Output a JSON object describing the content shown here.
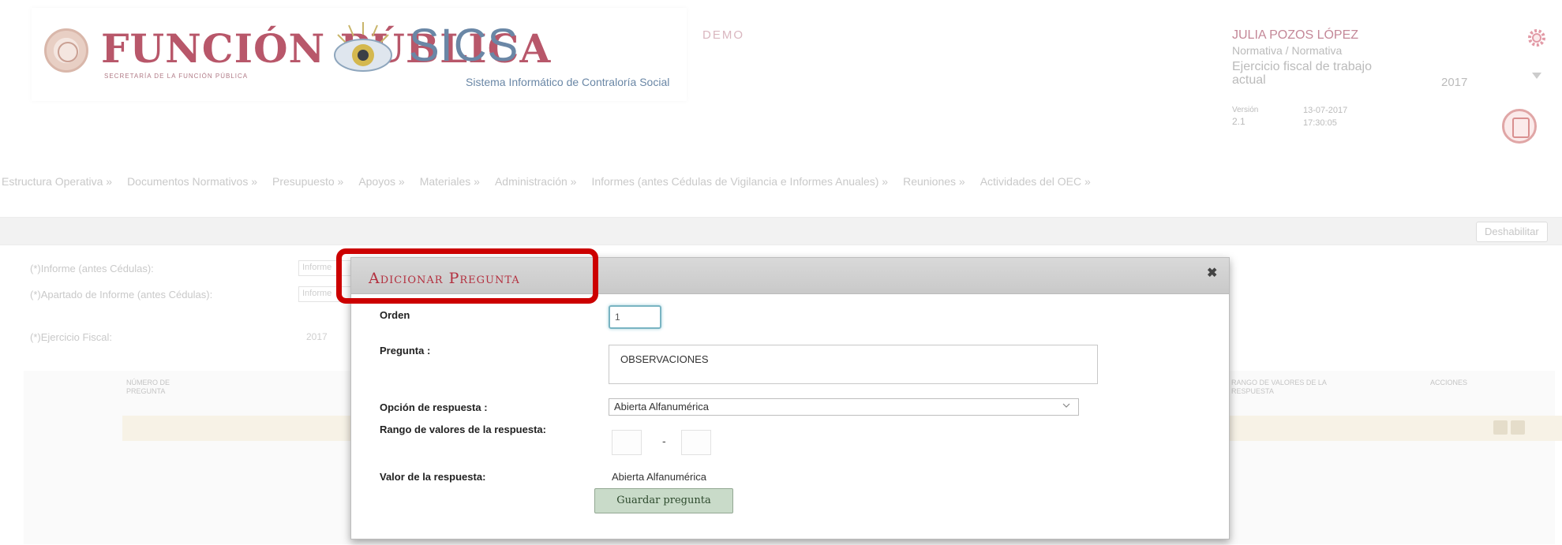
{
  "header": {
    "fp_title": "FUNCIÓN PÚBLICA",
    "fp_subtitle": "SECRETARÍA DE LA FUNCIÓN PÚBLICA",
    "app_title": "SICS",
    "app_subtitle": "Sistema Informático de Contraloría Social",
    "environment": "DEMO"
  },
  "user": {
    "name": "JULIA POZOS LÓPEZ",
    "role": "Normativa / Normativa",
    "fiscal_label": "Ejercicio fiscal de trabajo actual",
    "fiscal_year": "2017",
    "version_label": "Versión",
    "version": "2.1",
    "date": "13-07-2017",
    "time": "17:30:05"
  },
  "menu": [
    "Estructura Operativa »",
    "Documentos Normativos »",
    "Presupuesto »",
    "Apoyos »",
    "Materiales »",
    "Administración »",
    "Informes (antes Cédulas de Vigilancia e Informes Anuales) »",
    "Reuniones »",
    "Actividades del OEC »"
  ],
  "toolbar": {
    "disable_label": "Deshabilitar"
  },
  "form": {
    "informe_label": "(*)Informe (antes Cédulas):",
    "informe_value": "Informe",
    "apartado_label": "(*)Apartado de Informe (antes Cédulas):",
    "apartado_value": "Informe",
    "ejercicio_label": "(*)Ejercicio Fiscal:",
    "ejercicio_value": "2017"
  },
  "table": {
    "col_1": "NÚMERO DE PREGUNTA",
    "col_2": "RANGO DE VALORES DE LA RESPUESTA",
    "col_3": "ACCIONES"
  },
  "modal": {
    "title": "Adicionar Pregunta",
    "orden_label": "Orden",
    "orden_value": "1",
    "pregunta_label": "Pregunta :",
    "pregunta_value": "OBSERVACIONES",
    "opcion_label": "Opción de respuesta :",
    "opcion_value": "Abierta Alfanumérica",
    "rango_label": "Rango de valores de la respuesta:",
    "rango_separator": "-",
    "valor_label": "Valor de la respuesta:",
    "valor_value": "Abierta Alfanumérica",
    "save_label": "Guardar pregunta",
    "close_glyph": "✖"
  },
  "colors": {
    "brand_red": "#b3303f",
    "highlight": "#cc0000",
    "save_button": "#c9dbc9"
  }
}
